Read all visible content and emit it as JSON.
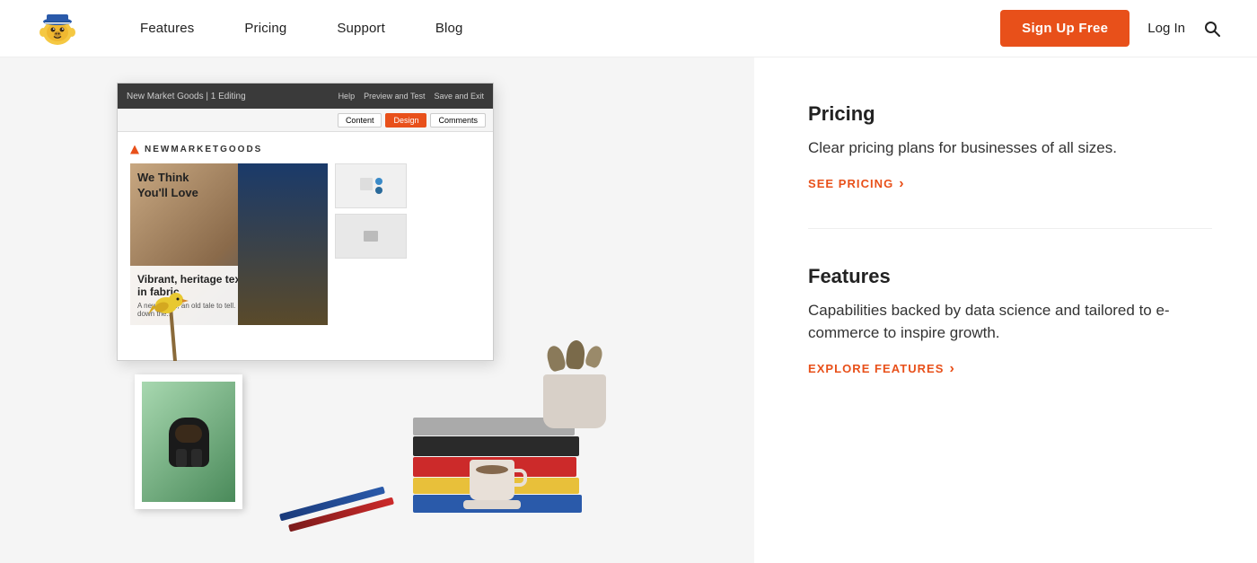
{
  "header": {
    "logo_alt": "Mailchimp",
    "nav_items": [
      "Features",
      "Pricing",
      "Support",
      "Blog"
    ],
    "signup_label": "Sign Up Free",
    "login_label": "Log In"
  },
  "mockup": {
    "topbar_left": "New Market Goods  |  1 Editing",
    "topbar_right_help": "Help",
    "topbar_right_preview": "Preview and Test",
    "topbar_right_save": "Save and Exit",
    "tab_content": "Content",
    "tab_design": "Design",
    "tab_comments": "Comments",
    "brand_name": "NEWMARKETGOODS",
    "headline": "We Think\nYou'll Love",
    "subhead": "Vibrant, heritage textiles\ntell stories in fabric",
    "subtext": "A new brand, an old tale to tell.\nGenerations have handed down the..."
  },
  "panel": {
    "pricing": {
      "title": "Pricing",
      "description": "Clear pricing plans for businesses of all sizes.",
      "link_label": "SEE PRICING"
    },
    "features": {
      "title": "Features",
      "description": "Capabilities backed by data science and tailored to e-commerce to inspire growth.",
      "link_label": "EXPLORE FEATURES"
    }
  },
  "colors": {
    "accent": "#e8501a",
    "text_primary": "#222222",
    "text_secondary": "#333333"
  }
}
